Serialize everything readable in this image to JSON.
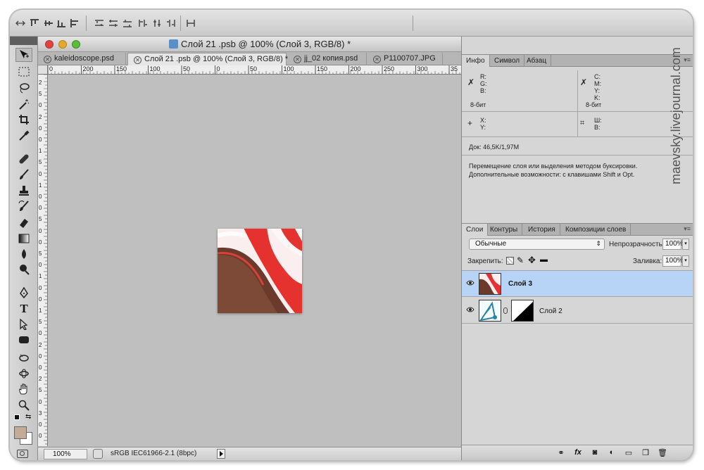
{
  "document": {
    "title": "Слой 21 .psb @ 100% (Слой 3, RGB/8) *",
    "tabs": [
      {
        "label": "kaleidoscope.psd",
        "active": false
      },
      {
        "label": "Слой 21 .psb @ 100% (Слой 3, RGB/8) *",
        "active": true
      },
      {
        "label": "jj_02 копия.psd",
        "active": false
      },
      {
        "label": "P1100707.JPG",
        "active": false
      }
    ],
    "ruler_h_labels": [
      "0",
      "200",
      "150",
      "100",
      "50",
      "0",
      "50",
      "100",
      "150",
      "200",
      "250",
      "300",
      "35"
    ],
    "ruler_v_labels": [
      "2",
      "5",
      "0",
      "2",
      "0",
      "0",
      "1",
      "5",
      "0",
      "1",
      "0",
      "0",
      "5",
      "0",
      "0",
      "5",
      "0",
      "1",
      "0",
      "0",
      "1",
      "5",
      "0",
      "2",
      "0",
      "0",
      "2",
      "5",
      "0",
      "3",
      "0",
      "0"
    ],
    "zoom": "100%",
    "status_profile": "sRGB IEC61966-2.1 (8bpc)"
  },
  "info_panel": {
    "tabs": [
      "Инфо",
      "Символ",
      "Абзац"
    ],
    "rgb_labels": [
      "R:",
      "G:",
      "B:"
    ],
    "cmyk_labels": [
      "C:",
      "M:",
      "Y:",
      "K:"
    ],
    "bit_left": "8-бит",
    "bit_right": "8-бит",
    "xy_labels": [
      "X:",
      "Y:"
    ],
    "wh_labels": [
      "Ш:",
      "В:"
    ],
    "doc_size": "Док: 46,5K/1,97M",
    "hint_line1": "Перемещение слоя или выделения методом буксировки.",
    "hint_line2": "Дополнительные возможности: с клавишами Shift и Opt."
  },
  "layers_panel": {
    "tabs": [
      "Слои",
      "Контуры",
      "История",
      "Композиции слоев"
    ],
    "blend_mode": "Обычные",
    "opacity_label": "Непрозрачность:",
    "opacity_value": "100%",
    "lock_label": "Закрепить:",
    "fill_label": "Заливка:",
    "fill_value": "100%",
    "layers": [
      {
        "name": "Слой 3",
        "selected": true
      },
      {
        "name": "Слой 2",
        "selected": false
      }
    ]
  },
  "watermark": "maevsky.livejournal.com",
  "colors": {
    "accent_selection": "#b7d3f5",
    "artwork_red": "#e6322f",
    "artwork_brown": "#6b3a2c",
    "artwork_white": "#fbeeee"
  },
  "icons": [
    "move-icon",
    "marquee-icon",
    "lasso-icon",
    "magic-wand-icon",
    "crop-icon",
    "eyedropper-icon",
    "healing-brush-icon",
    "brush-icon",
    "clone-stamp-icon",
    "history-brush-icon",
    "eraser-icon",
    "gradient-icon",
    "blur-icon",
    "dodge-icon",
    "pen-icon",
    "type-icon",
    "path-selection-icon",
    "shape-icon",
    "3d-rotate-icon",
    "3d-orbit-icon",
    "hand-icon",
    "zoom-icon"
  ]
}
